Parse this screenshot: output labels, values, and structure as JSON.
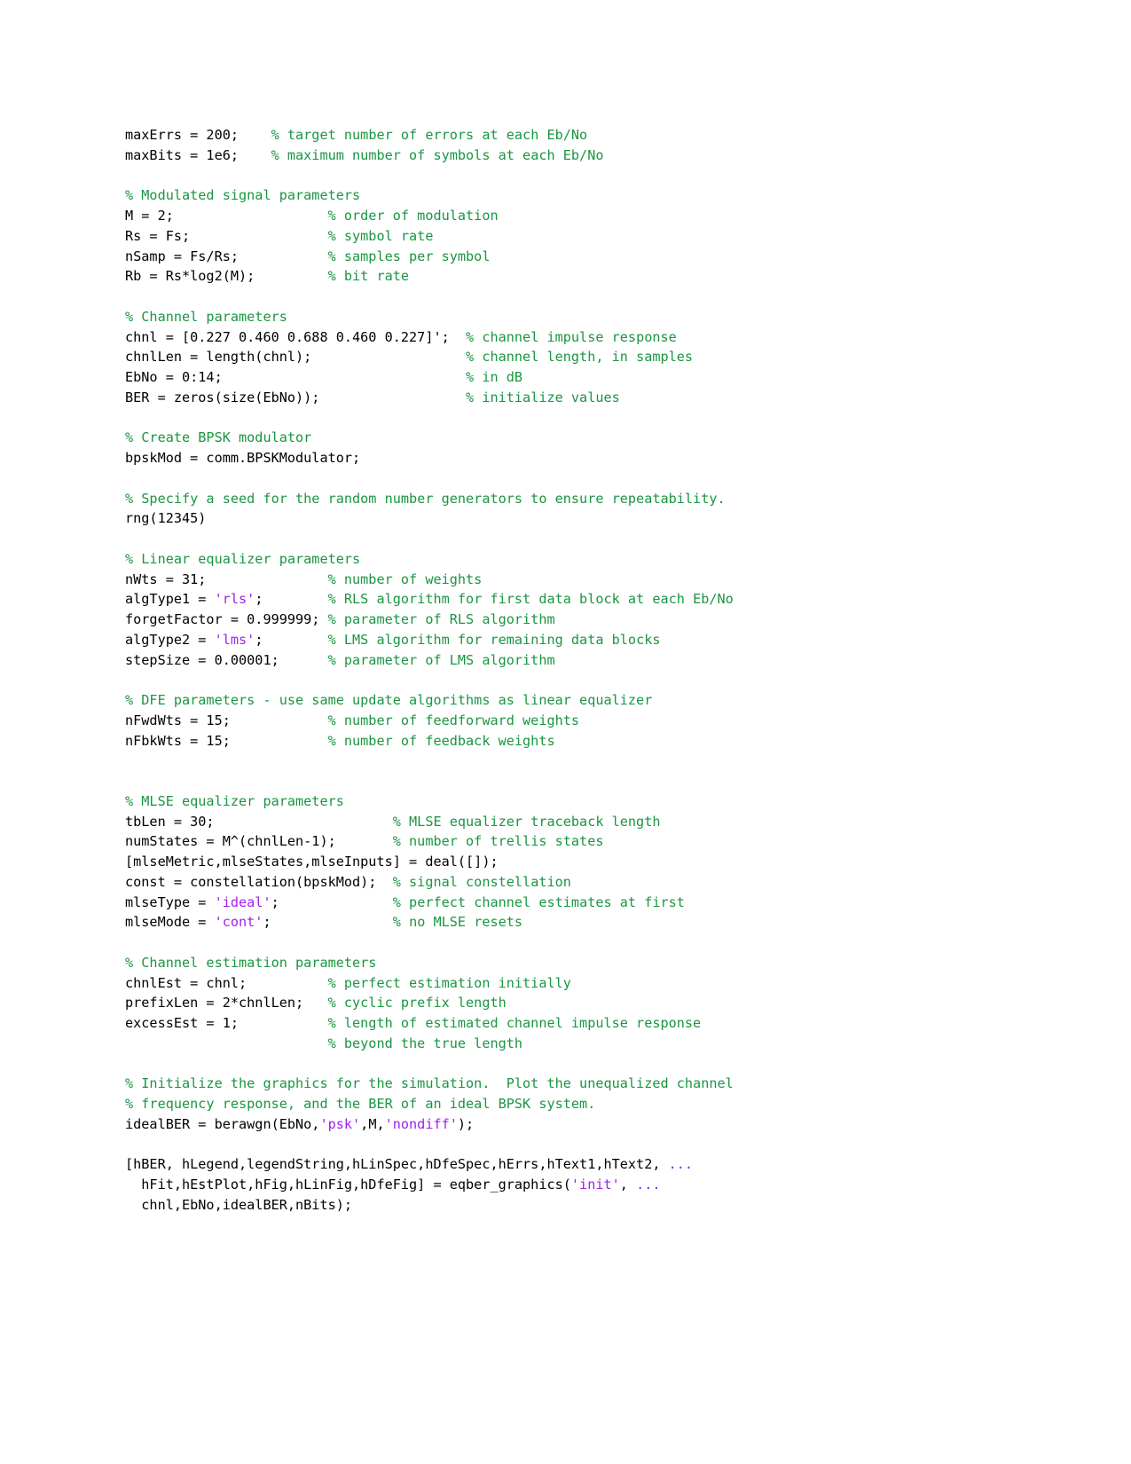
{
  "document": {
    "type": "matlab-code-listing",
    "background": "#ffffff",
    "colors": {
      "code": "#000000",
      "comment": "#1a9641",
      "string": "#a020f0",
      "continuation": "#3f3fff"
    },
    "lines": [
      {
        "segments": [
          {
            "t": "maxErrs = 200;    ",
            "c": "code"
          },
          {
            "t": "% target number of errors at each Eb/No",
            "c": "comment"
          }
        ]
      },
      {
        "segments": [
          {
            "t": "maxBits = 1e6;    ",
            "c": "code"
          },
          {
            "t": "% maximum number of symbols at each Eb/No",
            "c": "comment"
          }
        ]
      },
      {
        "segments": []
      },
      {
        "segments": [
          {
            "t": "% Modulated signal parameters",
            "c": "comment"
          }
        ]
      },
      {
        "segments": [
          {
            "t": "M = 2;                   ",
            "c": "code"
          },
          {
            "t": "% order of modulation",
            "c": "comment"
          }
        ]
      },
      {
        "segments": [
          {
            "t": "Rs = Fs;                 ",
            "c": "code"
          },
          {
            "t": "% symbol rate",
            "c": "comment"
          }
        ]
      },
      {
        "segments": [
          {
            "t": "nSamp = Fs/Rs;           ",
            "c": "code"
          },
          {
            "t": "% samples per symbol",
            "c": "comment"
          }
        ]
      },
      {
        "segments": [
          {
            "t": "Rb = Rs*log2(M);         ",
            "c": "code"
          },
          {
            "t": "% bit rate",
            "c": "comment"
          }
        ]
      },
      {
        "segments": []
      },
      {
        "segments": [
          {
            "t": "% Channel parameters",
            "c": "comment"
          }
        ]
      },
      {
        "segments": [
          {
            "t": "chnl = [0.227 0.460 0.688 0.460 0.227]';  ",
            "c": "code"
          },
          {
            "t": "% channel impulse response",
            "c": "comment"
          }
        ]
      },
      {
        "segments": [
          {
            "t": "chnlLen = length(chnl);                   ",
            "c": "code"
          },
          {
            "t": "% channel length, in samples",
            "c": "comment"
          }
        ]
      },
      {
        "segments": [
          {
            "t": "EbNo = 0:14;                              ",
            "c": "code"
          },
          {
            "t": "% in dB",
            "c": "comment"
          }
        ]
      },
      {
        "segments": [
          {
            "t": "BER = zeros(size(EbNo));                  ",
            "c": "code"
          },
          {
            "t": "% initialize values",
            "c": "comment"
          }
        ]
      },
      {
        "segments": []
      },
      {
        "segments": [
          {
            "t": "% Create BPSK modulator",
            "c": "comment"
          }
        ]
      },
      {
        "segments": [
          {
            "t": "bpskMod = comm.BPSKModulator;",
            "c": "code"
          }
        ]
      },
      {
        "segments": []
      },
      {
        "segments": [
          {
            "t": "% Specify a seed for the random number generators to ensure repeatability.",
            "c": "comment"
          }
        ]
      },
      {
        "segments": [
          {
            "t": "rng(12345)",
            "c": "code"
          }
        ]
      },
      {
        "segments": []
      },
      {
        "segments": [
          {
            "t": "% Linear equalizer parameters",
            "c": "comment"
          }
        ]
      },
      {
        "segments": [
          {
            "t": "nWts = 31;               ",
            "c": "code"
          },
          {
            "t": "% number of weights",
            "c": "comment"
          }
        ]
      },
      {
        "segments": [
          {
            "t": "algType1 = ",
            "c": "code"
          },
          {
            "t": "'rls'",
            "c": "string"
          },
          {
            "t": ";        ",
            "c": "code"
          },
          {
            "t": "% RLS algorithm for first data block at each Eb/No",
            "c": "comment"
          }
        ]
      },
      {
        "segments": [
          {
            "t": "forgetFactor = 0.999999; ",
            "c": "code"
          },
          {
            "t": "% parameter of RLS algorithm",
            "c": "comment"
          }
        ]
      },
      {
        "segments": [
          {
            "t": "algType2 = ",
            "c": "code"
          },
          {
            "t": "'lms'",
            "c": "string"
          },
          {
            "t": ";        ",
            "c": "code"
          },
          {
            "t": "% LMS algorithm for remaining data blocks",
            "c": "comment"
          }
        ]
      },
      {
        "segments": [
          {
            "t": "stepSize = 0.00001;      ",
            "c": "code"
          },
          {
            "t": "% parameter of LMS algorithm",
            "c": "comment"
          }
        ]
      },
      {
        "segments": []
      },
      {
        "segments": [
          {
            "t": "% DFE parameters - use same update algorithms as linear equalizer",
            "c": "comment"
          }
        ]
      },
      {
        "segments": [
          {
            "t": "nFwdWts = 15;            ",
            "c": "code"
          },
          {
            "t": "% number of feedforward weights",
            "c": "comment"
          }
        ]
      },
      {
        "segments": [
          {
            "t": "nFbkWts = 15;            ",
            "c": "code"
          },
          {
            "t": "% number of feedback weights",
            "c": "comment"
          }
        ]
      },
      {
        "segments": []
      },
      {
        "segments": []
      },
      {
        "segments": [
          {
            "t": "% MLSE equalizer parameters",
            "c": "comment"
          }
        ]
      },
      {
        "segments": [
          {
            "t": "tbLen = 30;                      ",
            "c": "code"
          },
          {
            "t": "% MLSE equalizer traceback length",
            "c": "comment"
          }
        ]
      },
      {
        "segments": [
          {
            "t": "numStates = M^(chnlLen-1);       ",
            "c": "code"
          },
          {
            "t": "% number of trellis states",
            "c": "comment"
          }
        ]
      },
      {
        "segments": [
          {
            "t": "[mlseMetric,mlseStates,mlseInputs] = deal([]);",
            "c": "code"
          }
        ]
      },
      {
        "segments": [
          {
            "t": "const = constellation(bpskMod);  ",
            "c": "code"
          },
          {
            "t": "% signal constellation",
            "c": "comment"
          }
        ]
      },
      {
        "segments": [
          {
            "t": "mlseType = ",
            "c": "code"
          },
          {
            "t": "'ideal'",
            "c": "string"
          },
          {
            "t": ";              ",
            "c": "code"
          },
          {
            "t": "% perfect channel estimates at first",
            "c": "comment"
          }
        ]
      },
      {
        "segments": [
          {
            "t": "mlseMode = ",
            "c": "code"
          },
          {
            "t": "'cont'",
            "c": "string"
          },
          {
            "t": ";               ",
            "c": "code"
          },
          {
            "t": "% no MLSE resets",
            "c": "comment"
          }
        ]
      },
      {
        "segments": []
      },
      {
        "segments": [
          {
            "t": "% Channel estimation parameters",
            "c": "comment"
          }
        ]
      },
      {
        "segments": [
          {
            "t": "chnlEst = chnl;          ",
            "c": "code"
          },
          {
            "t": "% perfect estimation initially",
            "c": "comment"
          }
        ]
      },
      {
        "segments": [
          {
            "t": "prefixLen = 2*chnlLen;   ",
            "c": "code"
          },
          {
            "t": "% cyclic prefix length",
            "c": "comment"
          }
        ]
      },
      {
        "segments": [
          {
            "t": "excessEst = 1;           ",
            "c": "code"
          },
          {
            "t": "% length of estimated channel impulse response",
            "c": "comment"
          }
        ]
      },
      {
        "segments": [
          {
            "t": "                         ",
            "c": "code"
          },
          {
            "t": "% beyond the true length",
            "c": "comment"
          }
        ]
      },
      {
        "segments": []
      },
      {
        "segments": [
          {
            "t": "% Initialize the graphics for the simulation.  Plot the unequalized channel",
            "c": "comment"
          }
        ]
      },
      {
        "segments": [
          {
            "t": "% frequency response, and the BER of an ideal BPSK system.",
            "c": "comment"
          }
        ]
      },
      {
        "segments": [
          {
            "t": "idealBER = berawgn(EbNo,",
            "c": "code"
          },
          {
            "t": "'psk'",
            "c": "string"
          },
          {
            "t": ",M,",
            "c": "code"
          },
          {
            "t": "'nondiff'",
            "c": "string"
          },
          {
            "t": ");",
            "c": "code"
          }
        ]
      },
      {
        "segments": []
      },
      {
        "segments": [
          {
            "t": "[hBER, hLegend,legendString,hLinSpec,hDfeSpec,hErrs,hText1,hText2, ",
            "c": "code"
          },
          {
            "t": "...",
            "c": "continuation"
          }
        ]
      },
      {
        "segments": [
          {
            "t": "  hFit,hEstPlot,hFig,hLinFig,hDfeFig] = eqber_graphics(",
            "c": "code"
          },
          {
            "t": "'init'",
            "c": "string"
          },
          {
            "t": ", ",
            "c": "code"
          },
          {
            "t": "...",
            "c": "continuation"
          }
        ]
      },
      {
        "segments": [
          {
            "t": "  chnl,EbNo,idealBER,nBits);",
            "c": "code"
          }
        ]
      }
    ]
  }
}
